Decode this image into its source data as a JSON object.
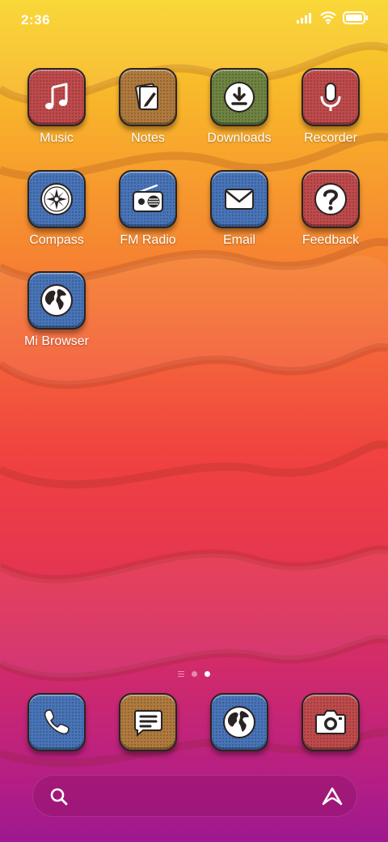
{
  "status_bar": {
    "time": "2:36",
    "signal_icon": "signal-bars-icon",
    "wifi_icon": "wifi-icon",
    "battery_icon": "battery-icon"
  },
  "home_apps": [
    {
      "label": "Music",
      "icon": "music-note-icon",
      "color": "#bf4a4c"
    },
    {
      "label": "Notes",
      "icon": "notes-icon",
      "color": "#b07a3e"
    },
    {
      "label": "Downloads",
      "icon": "download-icon",
      "color": "#6f8442"
    },
    {
      "label": "Recorder",
      "icon": "microphone-icon",
      "color": "#bf4a4c"
    },
    {
      "label": "Compass",
      "icon": "compass-icon",
      "color": "#4874b8"
    },
    {
      "label": "FM Radio",
      "icon": "radio-icon",
      "color": "#4874b8"
    },
    {
      "label": "Email",
      "icon": "envelope-icon",
      "color": "#4874b8"
    },
    {
      "label": "Feedback",
      "icon": "question-icon",
      "color": "#bf4a4c"
    },
    {
      "label": "Mi Browser",
      "icon": "globe-icon",
      "color": "#4874b8"
    }
  ],
  "page_indicator": {
    "pages": 2,
    "current": 2
  },
  "dock": [
    {
      "icon": "phone-icon",
      "color": "#4874b8"
    },
    {
      "icon": "messages-icon",
      "color": "#b07a3e"
    },
    {
      "icon": "globe-icon",
      "color": "#4874b8"
    },
    {
      "icon": "camera-icon",
      "color": "#bf4a4c"
    }
  ],
  "search": {
    "placeholder": "",
    "left_icon": "search-icon",
    "right_icon": "assistant-icon"
  }
}
